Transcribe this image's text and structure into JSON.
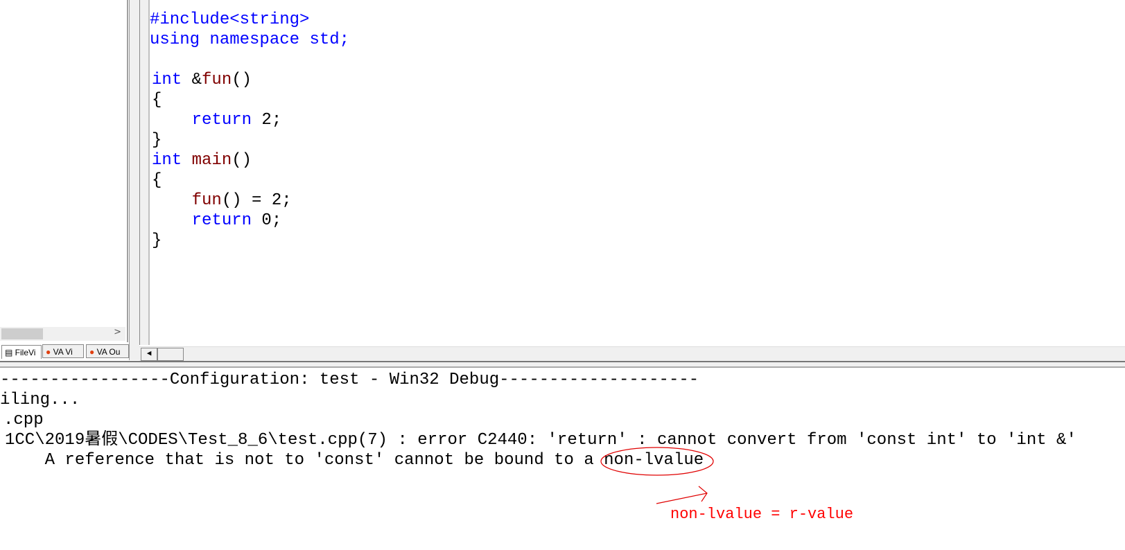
{
  "editor": {
    "lines": [
      [
        {
          "t": "#include<string>",
          "c": "kw"
        }
      ],
      [
        {
          "t": "using namespace std;",
          "c": "kw2"
        }
      ],
      [],
      [
        {
          "t": "int",
          "c": "kw"
        },
        {
          "t": " &"
        },
        {
          "t": "fun",
          "c": "fn"
        },
        {
          "t": "()"
        }
      ],
      [
        {
          "t": "{"
        }
      ],
      [
        {
          "t": "    "
        },
        {
          "t": "return",
          "c": "kw"
        },
        {
          "t": " 2;"
        }
      ],
      [
        {
          "t": "}"
        }
      ],
      [
        {
          "t": "int",
          "c": "kw"
        },
        {
          "t": " "
        },
        {
          "t": "main",
          "c": "fn"
        },
        {
          "t": "()"
        }
      ],
      [
        {
          "t": "{"
        }
      ],
      [
        {
          "t": "    "
        },
        {
          "t": "fun",
          "c": "fn"
        },
        {
          "t": "() = 2;"
        }
      ],
      [
        {
          "t": "    "
        },
        {
          "t": "return",
          "c": "kw"
        },
        {
          "t": " 0;"
        }
      ],
      [
        {
          "t": "}"
        }
      ]
    ]
  },
  "sidebar": {
    "tabs": [
      {
        "label": "FileVi"
      },
      {
        "label": "VA Vi"
      },
      {
        "label": "VA Ou"
      }
    ]
  },
  "output": {
    "lines": [
      "-----------------Configuration: test - Win32 Debug--------------------",
      "iling...",
      ".cpp",
      "1CC\\2019暑假\\CODES\\Test_8_6\\test.cpp(7) : error C2440: 'return' : cannot convert from 'const int' to 'int &'",
      "    A reference that is not to 'const' cannot be bound to a non-lvalue"
    ]
  },
  "annotation": {
    "text": "non-lvalue = r-value",
    "color": "#ff0000"
  }
}
